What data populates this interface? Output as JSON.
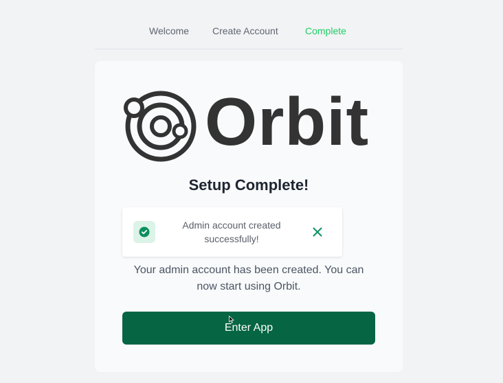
{
  "stepper": {
    "steps": [
      {
        "label": "Welcome"
      },
      {
        "label": "Create Account"
      },
      {
        "label": "Complete"
      }
    ],
    "active_color": "#1fce63"
  },
  "logo": {
    "text": "Orbit"
  },
  "setup": {
    "title": "Setup Complete!"
  },
  "toast": {
    "icon": "check-circle-icon",
    "message": "Admin account created successfully!",
    "close_icon": "close-icon",
    "accent_color": "#0b8f5e"
  },
  "description": "Your admin account has been created. You can now start using Orbit.",
  "button": {
    "label": "Enter App",
    "color": "#066543"
  }
}
